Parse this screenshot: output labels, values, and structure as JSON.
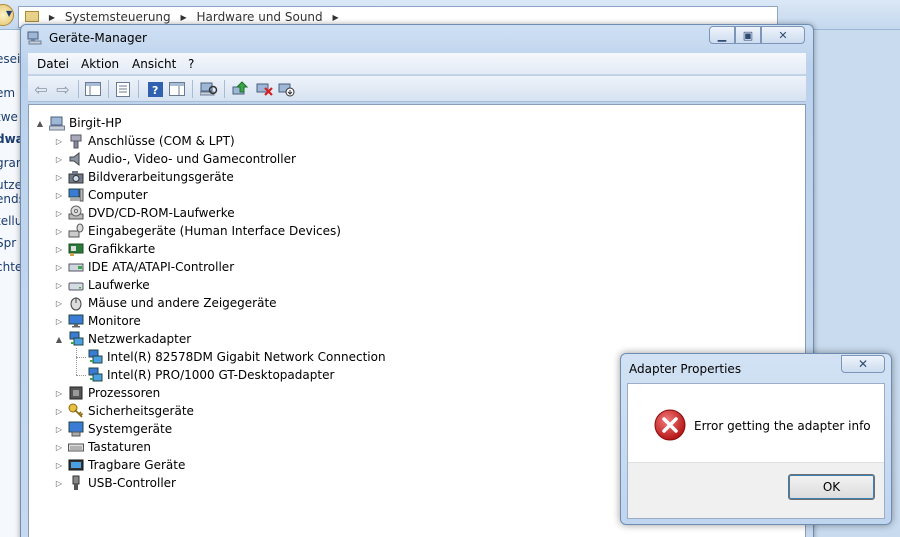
{
  "background": {
    "breadcrumb": [
      "Systemsteuerung",
      "Hardware und Sound"
    ],
    "sidebar_fragments": [
      "eseit",
      "em",
      "twe",
      "dwa",
      "gran",
      "utze",
      "ends",
      "tellu",
      "Spr",
      "chte"
    ]
  },
  "window": {
    "title": "Geräte-Manager",
    "menu": [
      "Datei",
      "Aktion",
      "Ansicht",
      "?"
    ]
  },
  "tree": {
    "root": "Birgit-HP",
    "categories": [
      {
        "label": "Anschlüsse (COM & LPT)",
        "icon": "port-icon"
      },
      {
        "label": "Audio-, Video- und Gamecontroller",
        "icon": "speaker-icon"
      },
      {
        "label": "Bildverarbeitungsgeräte",
        "icon": "camera-icon"
      },
      {
        "label": "Computer",
        "icon": "computer-icon"
      },
      {
        "label": "DVD/CD-ROM-Laufwerke",
        "icon": "disc-drive-icon"
      },
      {
        "label": "Eingabegeräte (Human Interface Devices)",
        "icon": "hid-icon"
      },
      {
        "label": "Grafikkarte",
        "icon": "display-adapter-icon"
      },
      {
        "label": "IDE ATA/ATAPI-Controller",
        "icon": "ide-controller-icon"
      },
      {
        "label": "Laufwerke",
        "icon": "drive-icon"
      },
      {
        "label": "Mäuse und andere Zeigegeräte",
        "icon": "mouse-icon"
      },
      {
        "label": "Monitore",
        "icon": "monitor-icon"
      },
      {
        "label": "Netzwerkadapter",
        "icon": "network-adapter-icon",
        "expanded": true
      },
      {
        "label": "Prozessoren",
        "icon": "processor-icon"
      },
      {
        "label": "Sicherheitsgeräte",
        "icon": "security-key-icon"
      },
      {
        "label": "Systemgeräte",
        "icon": "system-device-icon"
      },
      {
        "label": "Tastaturen",
        "icon": "keyboard-icon"
      },
      {
        "label": "Tragbare Geräte",
        "icon": "portable-device-icon"
      },
      {
        "label": "USB-Controller",
        "icon": "usb-icon"
      }
    ],
    "network_children": [
      "Intel(R) 82578DM Gigabit Network Connection",
      "Intel(R) PRO/1000 GT-Desktopadapter"
    ]
  },
  "dialog": {
    "title": "Adapter Properties",
    "message": "Error getting the adapter info",
    "ok_label": "OK"
  }
}
